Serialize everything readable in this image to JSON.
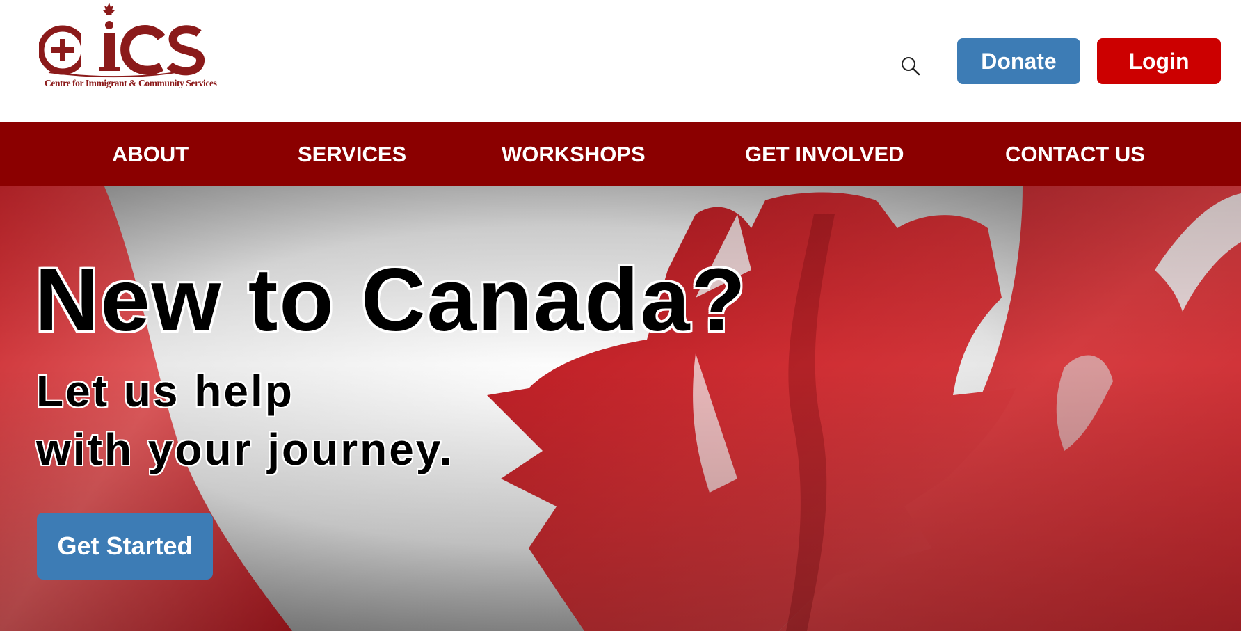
{
  "header": {
    "logo": {
      "wordmark": "CICS",
      "tagline": "Centre for Immigrant & Community Services"
    },
    "search": {
      "icon": "search-icon"
    },
    "donate_label": "Donate",
    "login_label": "Login"
  },
  "nav": {
    "items": [
      {
        "label": "ABOUT"
      },
      {
        "label": "SERVICES"
      },
      {
        "label": "WORKSHOPS"
      },
      {
        "label": "GET INVOLVED"
      },
      {
        "label": "CONTACT US"
      }
    ]
  },
  "hero": {
    "title": "New to Canada?",
    "subtitle_line1": "Let us help",
    "subtitle_line2": "with your journey.",
    "cta_label": "Get Started",
    "background": "canadian-flag-image"
  },
  "colors": {
    "brand_red": "#8b0000",
    "login_red": "#cc0000",
    "accent_blue": "#3d7cb5"
  }
}
